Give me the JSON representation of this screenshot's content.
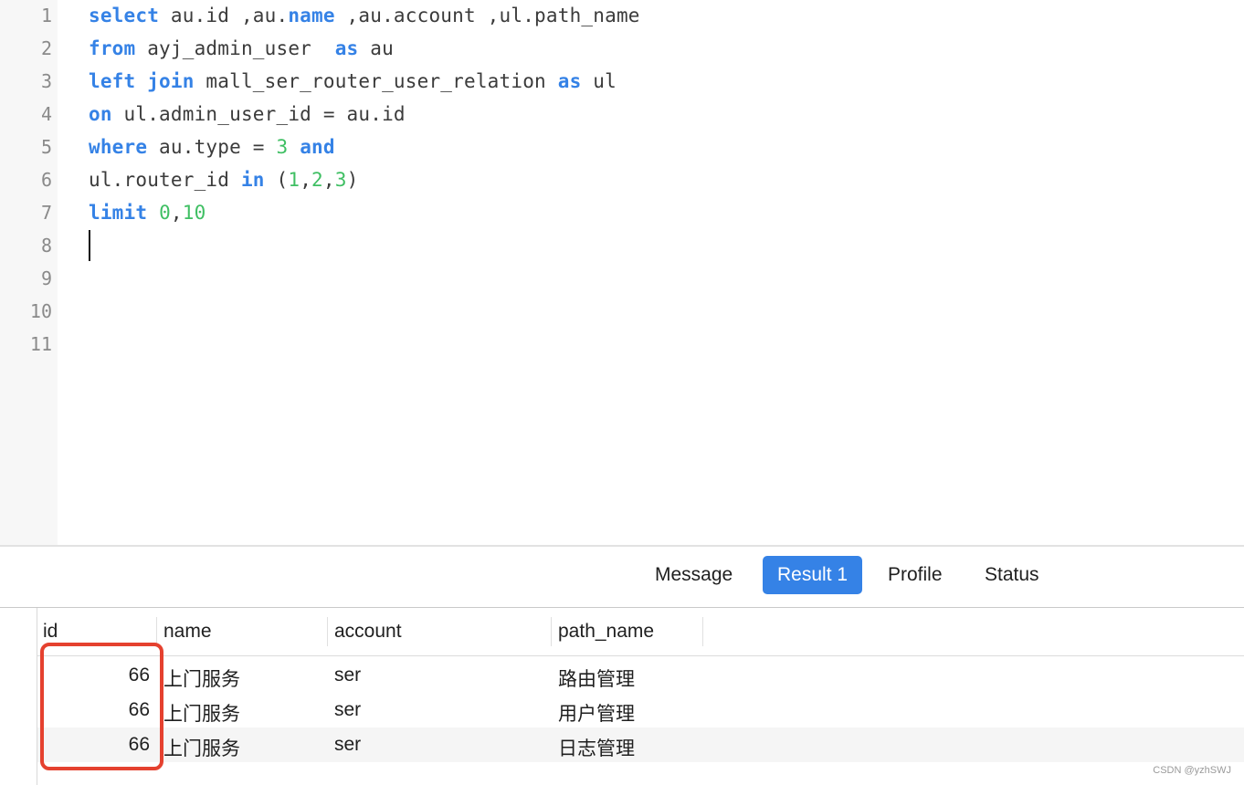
{
  "editor": {
    "lines": [
      {
        "n": "1",
        "tokens": [
          [
            "kw",
            "select"
          ],
          [
            "t",
            " au.id ,au."
          ],
          [
            "kw",
            "name"
          ],
          [
            "t",
            " ,au.account ,ul.path_name"
          ]
        ]
      },
      {
        "n": "2",
        "tokens": [
          [
            "kw",
            "from"
          ],
          [
            "t",
            " ayj_admin_user  "
          ],
          [
            "kw",
            "as"
          ],
          [
            "t",
            " au"
          ]
        ]
      },
      {
        "n": "3",
        "tokens": [
          [
            "kw",
            "left"
          ],
          [
            "t",
            " "
          ],
          [
            "kw",
            "join"
          ],
          [
            "t",
            " mall_ser_router_user_relation "
          ],
          [
            "kw",
            "as"
          ],
          [
            "t",
            " ul"
          ]
        ]
      },
      {
        "n": "4",
        "tokens": [
          [
            "kw",
            "on"
          ],
          [
            "t",
            " ul.admin_user_id = au.id"
          ]
        ]
      },
      {
        "n": "5",
        "tokens": [
          [
            "kw",
            "where"
          ],
          [
            "t",
            " au.type = "
          ],
          [
            "num",
            "3"
          ],
          [
            "t",
            " "
          ],
          [
            "kw",
            "and"
          ]
        ]
      },
      {
        "n": "6",
        "tokens": [
          [
            "t",
            "ul.router_id "
          ],
          [
            "kw",
            "in"
          ],
          [
            "t",
            " ("
          ],
          [
            "num",
            "1"
          ],
          [
            "t",
            ","
          ],
          [
            "num",
            "2"
          ],
          [
            "t",
            ","
          ],
          [
            "num",
            "3"
          ],
          [
            "t",
            ")"
          ]
        ]
      },
      {
        "n": "7",
        "tokens": [
          [
            "kw",
            "limit"
          ],
          [
            "t",
            " "
          ],
          [
            "num",
            "0"
          ],
          [
            "t",
            ","
          ],
          [
            "num",
            "10"
          ]
        ]
      },
      {
        "n": "8",
        "tokens": []
      },
      {
        "n": "9",
        "tokens": []
      },
      {
        "n": "10",
        "tokens": []
      },
      {
        "n": "11",
        "tokens": []
      }
    ],
    "caret_line": 8
  },
  "tabs": [
    {
      "label": "Message",
      "active": false
    },
    {
      "label": "Result 1",
      "active": true
    },
    {
      "label": "Profile",
      "active": false
    },
    {
      "label": "Status",
      "active": false
    }
  ],
  "grid": {
    "columns": [
      "id",
      "name",
      "account",
      "path_name"
    ],
    "rows": [
      [
        "66",
        "上门服务",
        "ser",
        "路由管理"
      ],
      [
        "66",
        "上门服务",
        "ser",
        "用户管理"
      ],
      [
        "66",
        "上门服务",
        "ser",
        "日志管理"
      ]
    ]
  },
  "colors": {
    "keyword": "#3582e6",
    "number": "#3fbf63",
    "active_tab": "#3582e6",
    "highlight": "#e5412f"
  },
  "watermark": "CSDN @yzhSWJ"
}
